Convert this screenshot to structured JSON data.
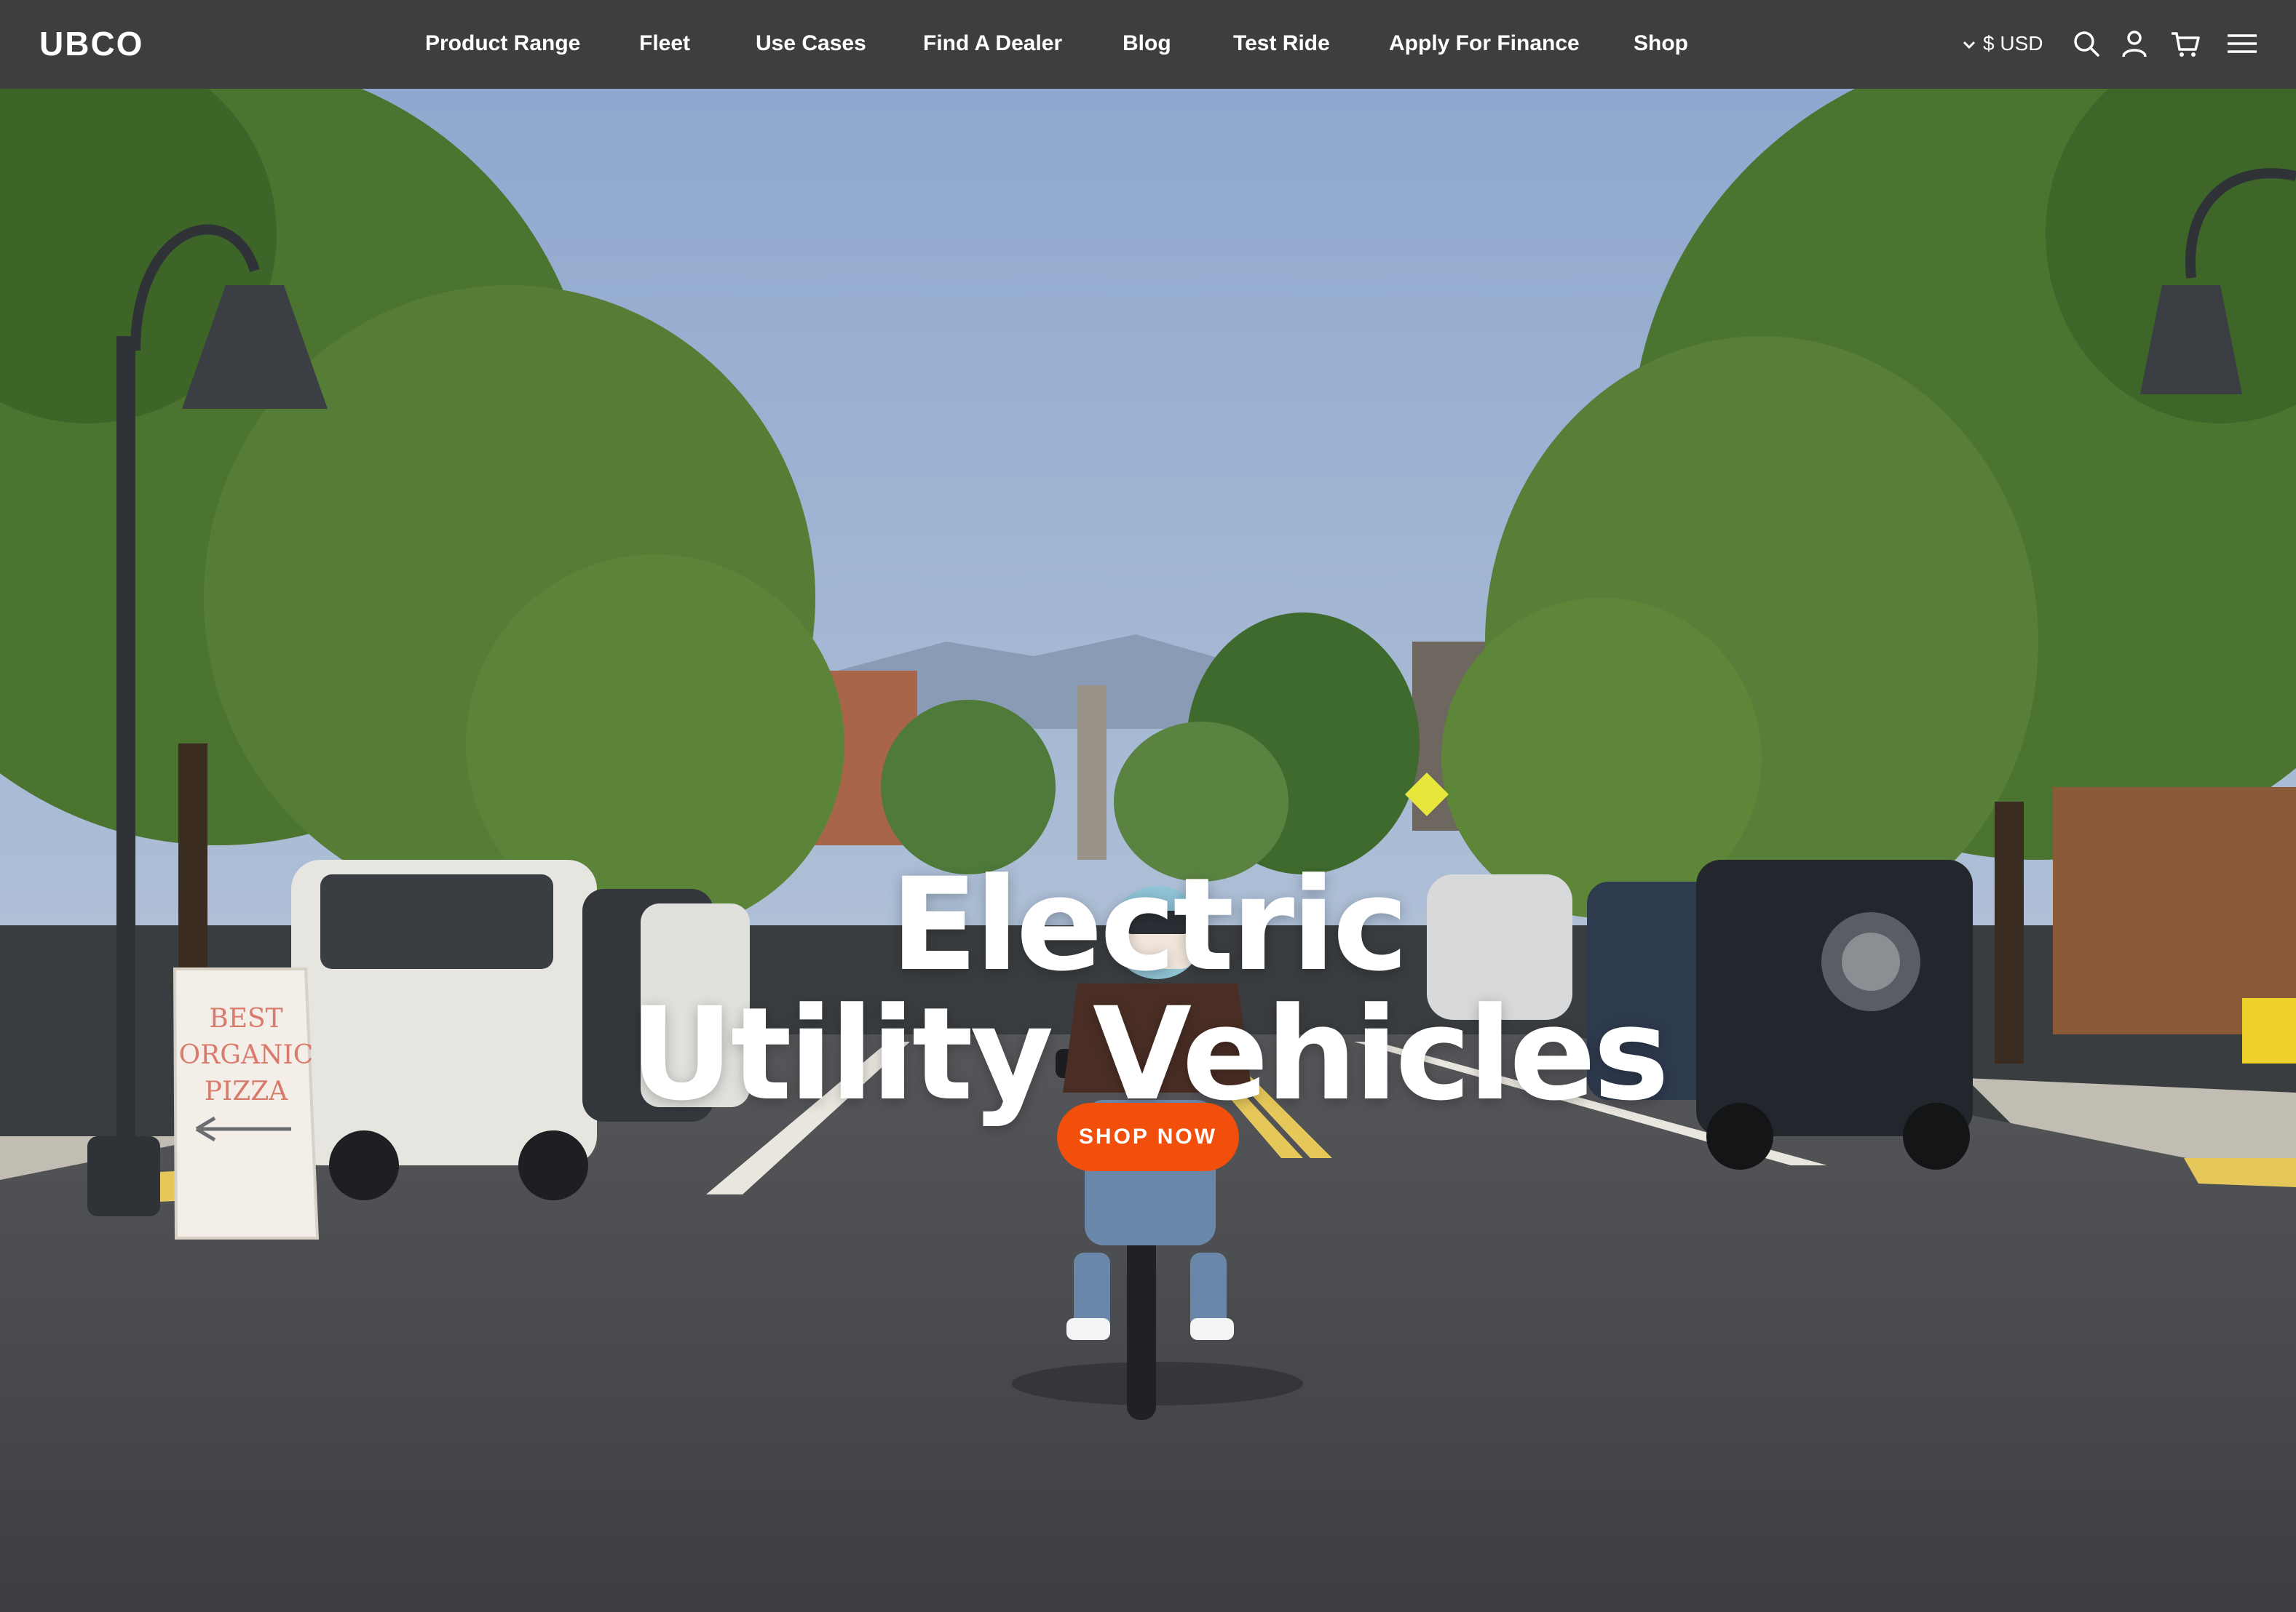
{
  "brand": {
    "logo_text": "UBCO"
  },
  "nav": {
    "items": [
      {
        "label": "Product Range"
      },
      {
        "label": "Fleet"
      },
      {
        "label": "Use Cases"
      },
      {
        "label": "Find A Dealer"
      },
      {
        "label": "Blog"
      },
      {
        "label": "Test Ride"
      },
      {
        "label": "Apply For Finance"
      },
      {
        "label": "Shop"
      }
    ],
    "currency": "$ USD",
    "icons": [
      "chevron-down-icon",
      "search-icon",
      "account-icon",
      "cart-icon",
      "menu-icon"
    ]
  },
  "hero": {
    "headline_line1": "Electric",
    "headline_line2": "Utility Vehicles",
    "cta_label": "SHOP NOW",
    "sign_text": [
      "BEST",
      "ORGANIC",
      "PIZZA"
    ]
  },
  "colors": {
    "nav_bg": "#3e3e3e",
    "cta": "#f24e0c",
    "text": "#ffffff"
  }
}
